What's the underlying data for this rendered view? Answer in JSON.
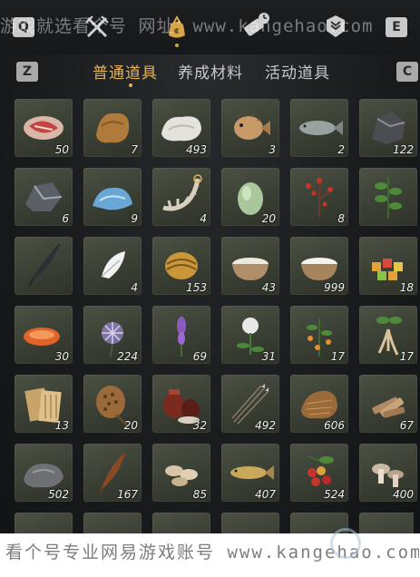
{
  "top_keys": {
    "left": "Q",
    "right": "E"
  },
  "tab_keys": {
    "left": "Z",
    "right": "C"
  },
  "top_icons": [
    {
      "name": "crossed-swords-icon",
      "active": false
    },
    {
      "name": "pouch-icon",
      "active": true
    },
    {
      "name": "scroll-clock-icon",
      "active": false
    },
    {
      "name": "scroll-badge-icon",
      "active": false
    }
  ],
  "tabs": [
    {
      "label": "普通道具",
      "active": true
    },
    {
      "label": "养成材料",
      "active": false
    },
    {
      "label": "活动道具",
      "active": false
    }
  ],
  "watermark_top": "游戏就选看个号  网址：www.kangehao.com",
  "watermark_bottom": "看个号专业网易游戏账号 www.kangehao.com",
  "items": [
    {
      "icon": "raw-meat",
      "qty": "50"
    },
    {
      "icon": "pelt",
      "qty": "7"
    },
    {
      "icon": "white-fur",
      "qty": "493"
    },
    {
      "icon": "pufferfish",
      "qty": "3"
    },
    {
      "icon": "fish",
      "qty": "2"
    },
    {
      "icon": "dark-ore",
      "qty": "122"
    },
    {
      "icon": "iron-ore",
      "qty": "6"
    },
    {
      "icon": "blue-crystal",
      "qty": "9"
    },
    {
      "icon": "bone-spine",
      "qty": "4"
    },
    {
      "icon": "melon",
      "qty": "20"
    },
    {
      "icon": "red-berry-branch",
      "qty": "8"
    },
    {
      "icon": "green-herb",
      "qty": ""
    },
    {
      "icon": "black-feather",
      "qty": ""
    },
    {
      "icon": "white-down",
      "qty": "4"
    },
    {
      "icon": "golden-scale",
      "qty": "153"
    },
    {
      "icon": "milk-bowl",
      "qty": "43"
    },
    {
      "icon": "rice-bowl",
      "qty": "999"
    },
    {
      "icon": "candy-pile",
      "qty": "18"
    },
    {
      "icon": "orange-shell",
      "qty": "30"
    },
    {
      "icon": "purple-flower",
      "qty": "224"
    },
    {
      "icon": "lavender-spike",
      "qty": "69"
    },
    {
      "icon": "dandelion",
      "qty": "31"
    },
    {
      "icon": "orange-fruit-plant",
      "qty": "17"
    },
    {
      "icon": "ginseng-root",
      "qty": "17"
    },
    {
      "icon": "bamboo-slips",
      "qty": "13"
    },
    {
      "icon": "lotus-seedpod",
      "qty": "20"
    },
    {
      "icon": "wine-jars",
      "qty": "32"
    },
    {
      "icon": "arrows",
      "qty": "492"
    },
    {
      "icon": "brown-fiber",
      "qty": "606"
    },
    {
      "icon": "wood-pieces",
      "qty": "67"
    },
    {
      "icon": "grey-stone",
      "qty": "502"
    },
    {
      "icon": "brown-feather",
      "qty": "167"
    },
    {
      "icon": "mushroom-slices",
      "qty": "85"
    },
    {
      "icon": "yellow-fish",
      "qty": "407"
    },
    {
      "icon": "red-berries",
      "qty": "524"
    },
    {
      "icon": "mushrooms",
      "qty": "400"
    }
  ]
}
